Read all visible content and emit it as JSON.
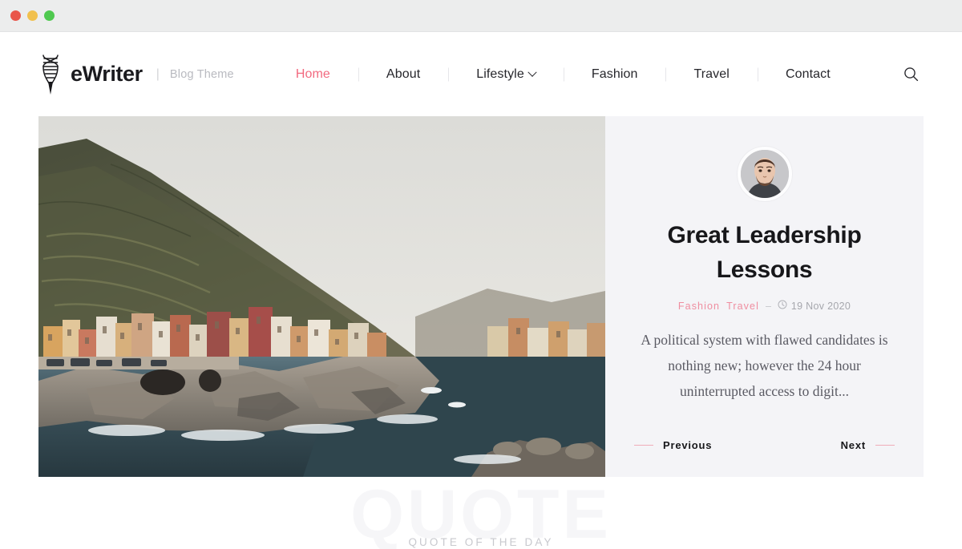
{
  "window": {
    "controls": [
      {
        "name": "close",
        "color": "#e9554a"
      },
      {
        "name": "minimize",
        "color": "#f1c04d"
      },
      {
        "name": "zoom",
        "color": "#4fc94f"
      }
    ]
  },
  "header": {
    "brand": {
      "icon": "quill-pen-icon",
      "name": "eWriter",
      "separator": "|",
      "tagline": "Blog Theme"
    },
    "nav": [
      {
        "label": "Home",
        "active": true,
        "has_dropdown": false
      },
      {
        "label": "About",
        "active": false,
        "has_dropdown": false
      },
      {
        "label": "Lifestyle",
        "active": false,
        "has_dropdown": true
      },
      {
        "label": "Fashion",
        "active": false,
        "has_dropdown": false
      },
      {
        "label": "Travel",
        "active": false,
        "has_dropdown": false
      },
      {
        "label": "Contact",
        "active": false,
        "has_dropdown": false
      }
    ],
    "search_icon": "search-icon"
  },
  "hero": {
    "image": {
      "alt": "Coastal cliffside village with colorful houses overlooking the sea",
      "icon": "hero-photo"
    },
    "post": {
      "avatar": "author-avatar",
      "title": "Great Leadership Lessons",
      "categories": [
        "Fashion",
        "Travel"
      ],
      "meta_dash": "–",
      "clock_icon": "clock-icon",
      "date": "19 Nov 2020",
      "excerpt": "A political system with flawed candidates is nothing new; however the 24 hour uninterrupted access to digit..."
    },
    "pager": {
      "previous_label": "Previous",
      "next_label": "Next"
    }
  },
  "quote": {
    "label": "QUOTE OF THE DAY",
    "watermark": "QUOTE"
  },
  "colors": {
    "accent": "#f2697f",
    "accent_soft": "#ef8ea0",
    "panel_bg": "#f4f4f7",
    "text": "#17171a",
    "muted": "#a6a7ad"
  }
}
